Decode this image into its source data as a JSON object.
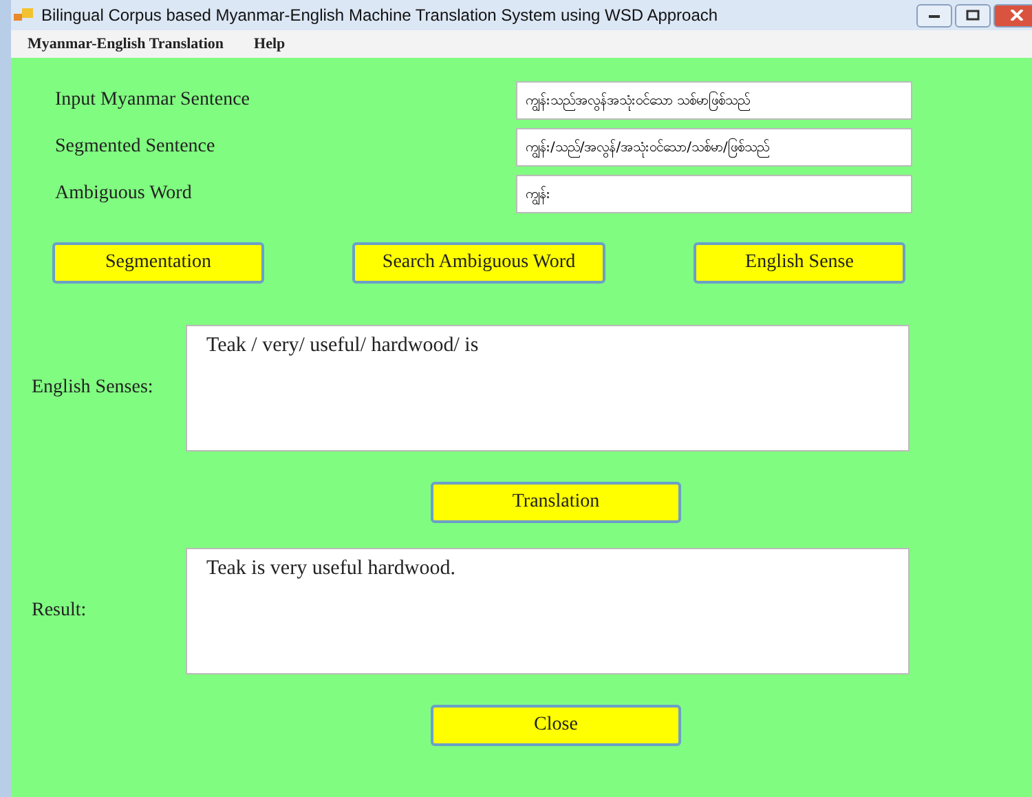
{
  "window": {
    "title": "Bilingual Corpus based Myanmar-English Machine Translation System using WSD Approach"
  },
  "menu": [
    "Myanmar-English Translation",
    "Help"
  ],
  "fields": [
    {
      "label": "Input Myanmar Sentence",
      "value": "ကျွန်းသည်အလွန်အသုံးဝင်သော သစ်မာဖြစ်သည်"
    },
    {
      "label": "Segmented Sentence",
      "value": "ကျွန်း/သည်/အလွန်/အသုံးဝင်သော/သစ်မာ/ဖြစ်သည်"
    },
    {
      "label": "Ambiguous Word",
      "value": "ကျွန်း"
    }
  ],
  "buttons": [
    "Segmentation",
    "Search Ambiguous Word",
    "English Sense"
  ],
  "senses": {
    "label": "English Senses:",
    "value": "Teak / very/ useful/ hardwood/ is"
  },
  "translate_button": "Translation",
  "result": {
    "label": "Result:",
    "value": "Teak is very useful hardwood."
  },
  "close_button": "Close"
}
